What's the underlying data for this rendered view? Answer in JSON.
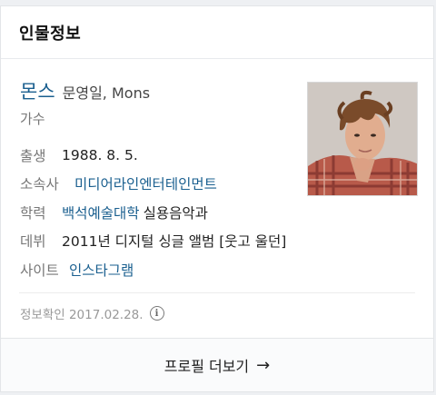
{
  "header": {
    "title": "인물정보"
  },
  "person": {
    "name": "몬스",
    "alias": "문영일, Mons",
    "occupation": "가수"
  },
  "info_rows": [
    {
      "label": "출생",
      "value": "1988. 8. 5."
    },
    {
      "label": "소속사",
      "value": "미디어라인엔터테인먼트"
    },
    {
      "label": "학력",
      "link": "백석예술대학",
      "value": "실용음악과"
    },
    {
      "label": "데뷔",
      "value": "2011년 디지털 싱글 앨범 [웃고 울던]"
    },
    {
      "label": "사이트",
      "value": "인스타그램"
    }
  ],
  "verified": {
    "text": "정보확인 2017.02.28.",
    "icon": "info-icon"
  },
  "footer": {
    "label": "프로필 더보기",
    "icon": "arrow-right-icon"
  },
  "colors": {
    "link": "#1a5f8f",
    "label": "#777777"
  }
}
